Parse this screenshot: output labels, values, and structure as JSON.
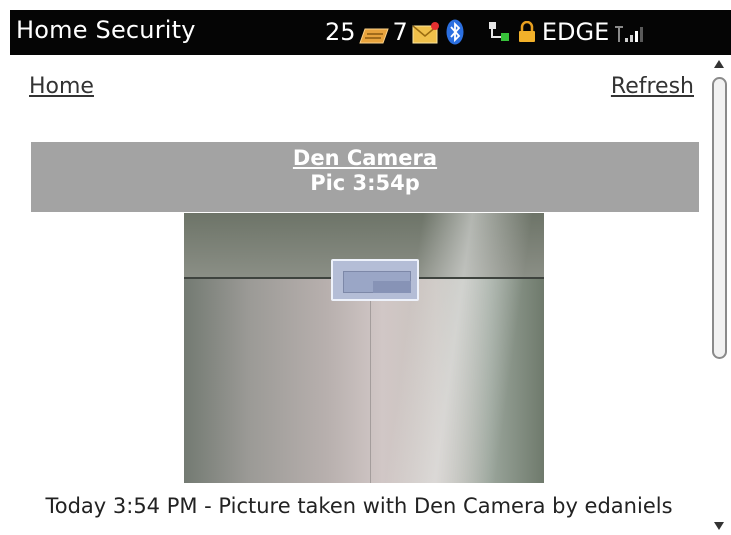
{
  "status_bar": {
    "app_title": "Home Security",
    "sms_count": "25",
    "mail_count": "7",
    "network_label": "EDGE",
    "icons": [
      "sms-icon",
      "mail-icon",
      "bluetooth-icon",
      "network-activity-icon",
      "lock-icon",
      "signal-icon"
    ]
  },
  "nav": {
    "home_label": "Home",
    "refresh_label": "Refresh"
  },
  "camera": {
    "name": "Den Camera",
    "pic_label": "Pic 3:54p",
    "caption": "Today 3:54 PM - Picture taken with Den Camera by edaniels"
  },
  "colors": {
    "status_bar_bg": "#050505",
    "header_bg": "#a3a3a3",
    "link_color": "#333333"
  }
}
